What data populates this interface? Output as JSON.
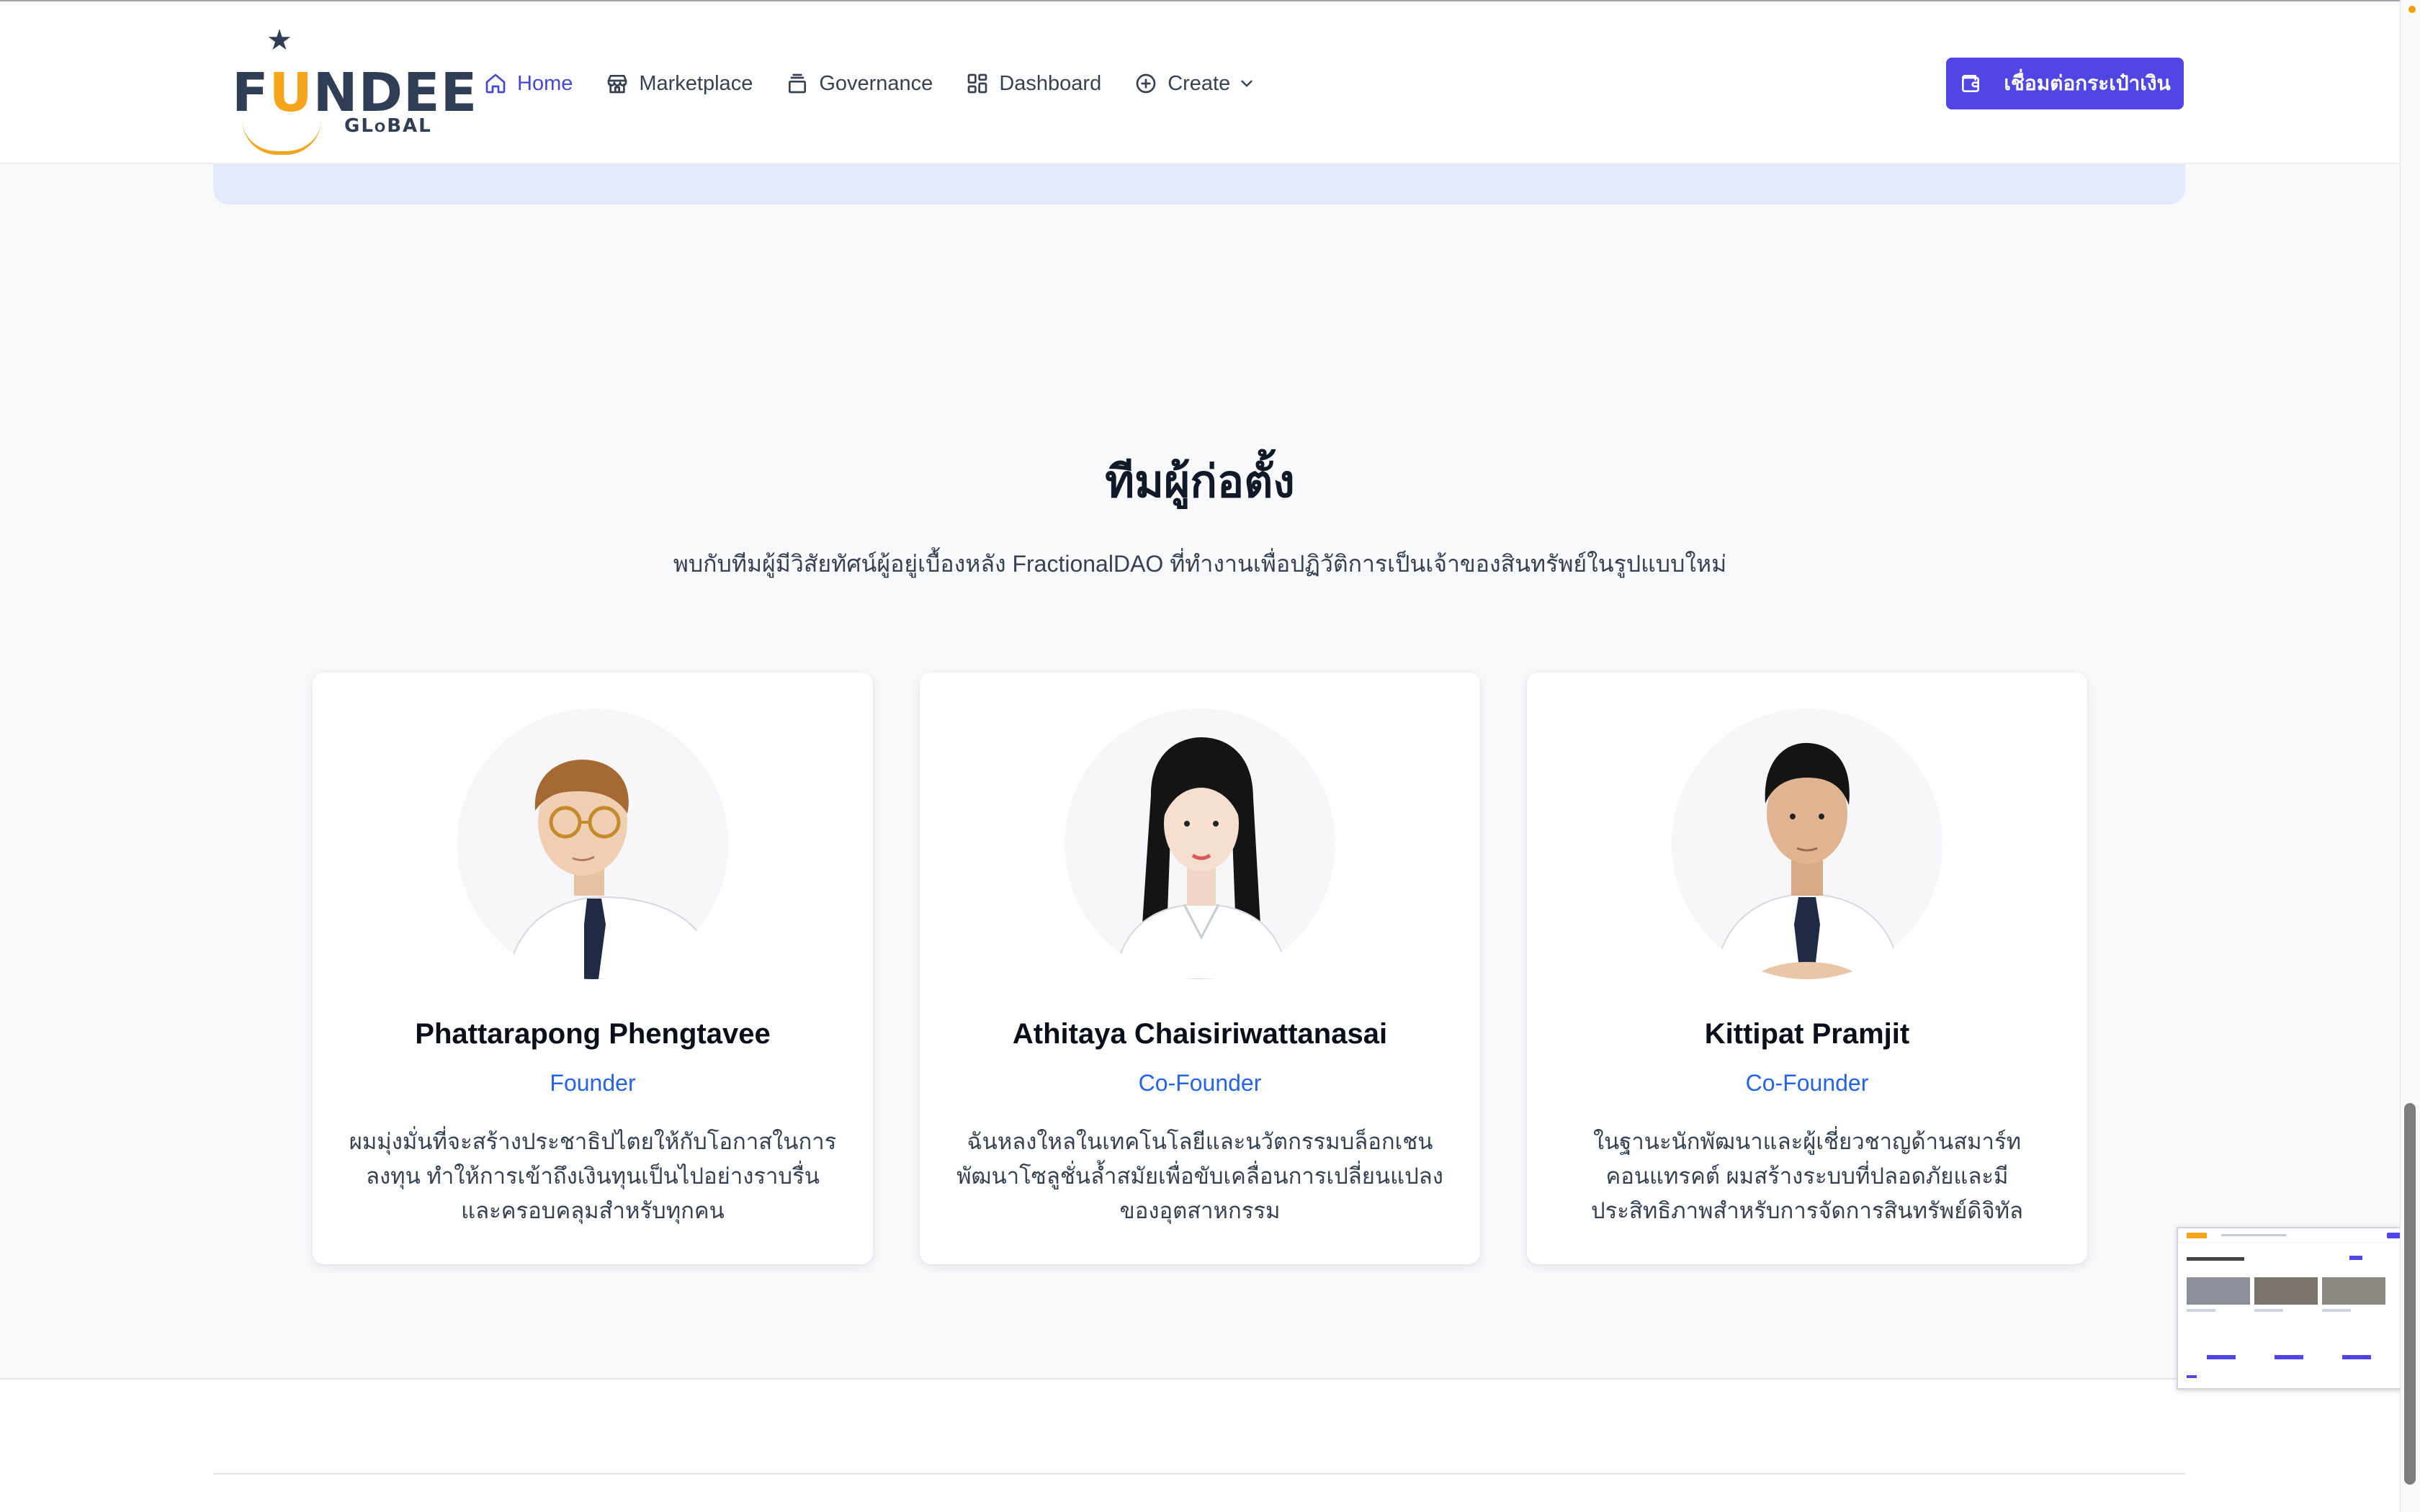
{
  "header": {
    "logo": {
      "brand": "FUNDEE",
      "sub": "GLOBAL"
    },
    "nav": [
      {
        "label": "Home",
        "icon": "home-icon",
        "active": true
      },
      {
        "label": "Marketplace",
        "icon": "store-icon"
      },
      {
        "label": "Governance",
        "icon": "stack-icon"
      },
      {
        "label": "Dashboard",
        "icon": "grid-icon"
      },
      {
        "label": "Create",
        "icon": "plus-circle-icon",
        "dropdown": true
      }
    ],
    "wallet_button": "เชื่อมต่อกระเป๋าเงิน"
  },
  "team": {
    "title": "ทีมผู้ก่อตั้ง",
    "subtitle": "พบกับทีมผู้มีวิสัยทัศน์ผู้อยู่เบื้องหลัง FractionalDAO ที่ทำงานเพื่อปฏิวัติการเป็นเจ้าของสินทรัพย์ในรูปแบบใหม่",
    "members": [
      {
        "name": "Phattarapong Phengtavee",
        "role": "Founder",
        "description": "ผมมุ่งมั่นที่จะสร้างประชาธิปไตยให้กับโอกาสในการลงทุน ทำให้การเข้าถึงเงินทุนเป็นไปอย่างราบรื่นและครอบคลุมสำหรับทุกคน"
      },
      {
        "name": "Athitaya Chaisiriwattanasai",
        "role": "Co-Founder",
        "description": "ฉันหลงใหลในเทคโนโลยีและนวัตกรรมบล็อกเชน พัฒนาโซลูชั่นล้ำสมัยเพื่อขับเคลื่อนการเปลี่ยนแปลงของอุตสาหกรรม"
      },
      {
        "name": "Kittipat Pramjit",
        "role": "Co-Founder",
        "description": "ในฐานะนักพัฒนาและผู้เชี่ยวชาญด้านสมาร์ทคอนแทรคต์ ผมสร้างระบบที่ปลอดภัยและมีประสิทธิภาพสำหรับการจัดการสินทรัพย์ดิจิทัล"
      }
    ]
  },
  "colors": {
    "accent": "#4f46e5",
    "nav_active": "#4547d6",
    "role_text": "#2563eb",
    "banner": "#e3e8fb"
  }
}
